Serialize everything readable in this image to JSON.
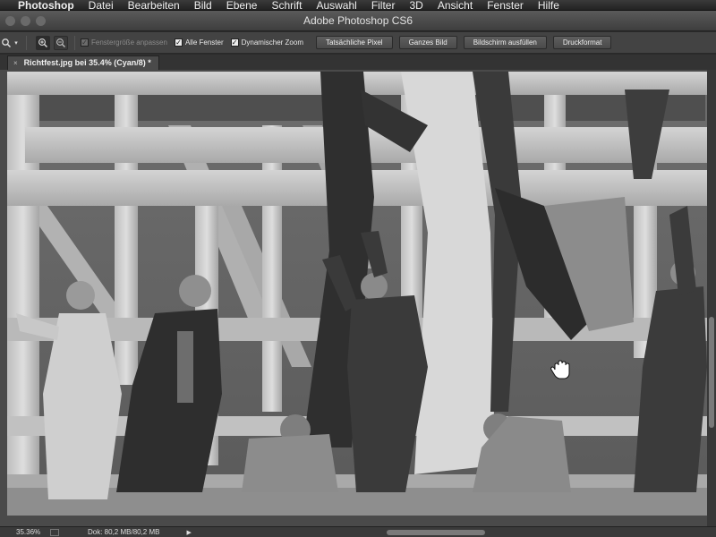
{
  "menubar": {
    "app_name": "Photoshop",
    "items": [
      "Datei",
      "Bearbeiten",
      "Bild",
      "Ebene",
      "Schrift",
      "Auswahl",
      "Filter",
      "3D",
      "Ansicht",
      "Fenster",
      "Hilfe"
    ]
  },
  "window": {
    "title": "Adobe Photoshop CS6"
  },
  "options": {
    "tool_icon": "zoom-tool-icon",
    "fit_window_label": "Fenstergröße anpassen",
    "fit_window_checked": "✓",
    "all_windows_label": "Alle Fenster",
    "all_windows_checked": "✓",
    "scrubby_zoom_label": "Dynamischer Zoom",
    "scrubby_zoom_checked": "✓",
    "buttons": [
      "Tatsächliche Pixel",
      "Ganzes Bild",
      "Bildschirm ausfüllen",
      "Druckformat"
    ]
  },
  "document": {
    "tab_label": "Richtfest.jpg bei 35.4% (Cyan/8) *",
    "close_glyph": "×"
  },
  "status": {
    "zoom": "35.36%",
    "doc_info": "Dok: 80,2 MB/80,2 MB",
    "arrow": "▶"
  }
}
